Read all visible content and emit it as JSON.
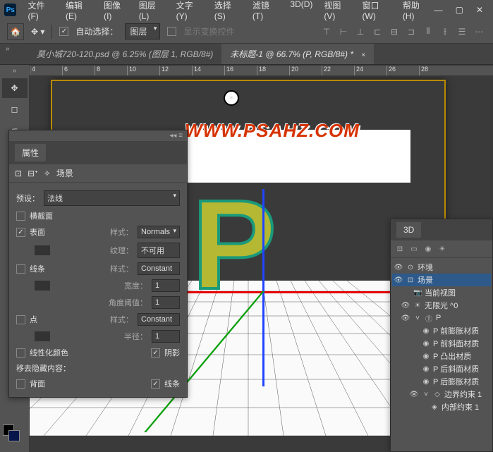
{
  "menu": {
    "file": "文件(F)",
    "edit": "编辑(E)",
    "image": "图像(I)",
    "layer": "图层(L)",
    "type": "文字(Y)",
    "select": "选择(S)",
    "filter": "滤镜(T)",
    "three_d": "3D(D)",
    "view": "视图(V)",
    "window": "窗口(W)",
    "help": "帮助(H)"
  },
  "options": {
    "auto_select": "自动选择：",
    "auto_select_mode": "图层",
    "show_transform": "显示变换控件"
  },
  "tabs": {
    "tab1": "莫小城720-120.psd @ 6.25% (图层 1, RGB/8#)",
    "tab2": "未标题-1 @ 66.7% (P, RGB/8#) *"
  },
  "ruler_ticks": [
    "4",
    "6",
    "8",
    "10",
    "12",
    "14",
    "16",
    "18",
    "20",
    "22",
    "24",
    "26",
    "28"
  ],
  "watermark": "WWW.PSAHZ.COM",
  "letter": "P",
  "properties": {
    "title": "属性",
    "scene_label": "场景",
    "preset_label": "预设：",
    "preset_value": "法线",
    "cross_section": "横截面",
    "surface": "表面",
    "style_label": "样式：",
    "surface_style": "Normals",
    "texture_label": "纹理：",
    "texture_value": "不可用",
    "lines": "线条",
    "line_style": "Constant",
    "width_label": "宽度：",
    "width_value": "1",
    "angle_label": "角度阈值：",
    "angle_value": "1",
    "points": "点",
    "point_style": "Constant",
    "radius_label": "半径：",
    "radius_value": "1",
    "linearize": "线性化颜色",
    "shadow": "阴影",
    "hidden_label": "移去隐藏内容：",
    "backface": "背面",
    "lines2": "线条"
  },
  "threed": {
    "title": "3D",
    "env": "环境",
    "scene": "场景",
    "current_view": "当前视图",
    "infinite_light": "无限光 ^0",
    "p": "P",
    "p_front_inflate": "P 前膨胀材质",
    "p_front_bevel": "P 前斜面材质",
    "p_extrude": "P 凸出材质",
    "p_back_bevel": "P 后斜面材质",
    "p_back_inflate": "P 后膨胀材质",
    "boundary": "边界约束  1",
    "internal": "内部约束  1"
  }
}
